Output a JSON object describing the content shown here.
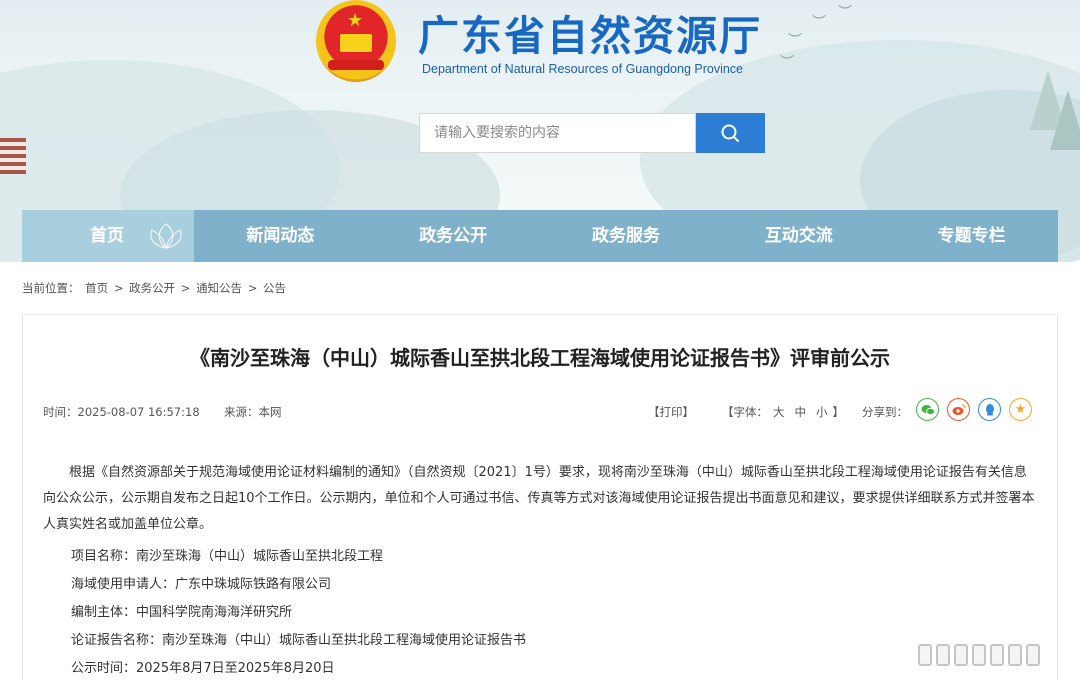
{
  "header": {
    "title": "广东省自然资源厅",
    "subtitle": "Department of Natural Resources of Guangdong Province",
    "search_placeholder": "请输入要搜索的内容"
  },
  "nav": {
    "items": [
      {
        "label": "首页",
        "active": true
      },
      {
        "label": "新闻动态"
      },
      {
        "label": "政务公开"
      },
      {
        "label": "政务服务"
      },
      {
        "label": "互动交流"
      },
      {
        "label": "专题专栏"
      }
    ]
  },
  "breadcrumb": {
    "prefix": "当前位置：",
    "items": [
      "首页",
      "政务公开",
      "通知公告",
      "公告"
    ],
    "separator": ">"
  },
  "article": {
    "title": "《南沙至珠海（中山）城际香山至拱北段工程海域使用论证报告书》评审前公示",
    "time": "时间：2025-08-07 16:57:18",
    "source": "来源：本网",
    "print_label": "【打印】",
    "font_prefix": "【字体：",
    "font_large": "大",
    "font_medium": "中",
    "font_small": "小",
    "font_suffix": "】",
    "share_label": "分享到：",
    "share_icons": [
      {
        "name": "wechat-icon",
        "color": "#3fb53f"
      },
      {
        "name": "weibo-icon",
        "color": "#e8572d"
      },
      {
        "name": "qq-icon",
        "color": "#2e8de0"
      },
      {
        "name": "qzone-icon",
        "color": "#f3a92a"
      }
    ],
    "paragraph": "根据《自然资源部关于规范海域使用论证材料编制的通知》（自然资规〔2021〕1号）要求，现将南沙至珠海（中山）城际香山至拱北段工程海域使用论证报告有关信息向公众公示，公示期自发布之日起10个工作日。公示期内，单位和个人可通过书信、传真等方式对该海域使用论证报告提出书面意见和建议，要求提供详细联系方式并签署本人真实姓名或加盖单位公章。",
    "details": [
      "项目名称：南沙至珠海（中山）城际香山至拱北段工程",
      "海域使用申请人：广东中珠城际铁路有限公司",
      "编制主体：中国科学院南海海洋研究所",
      "论证报告名称：南沙至珠海（中山）城际香山至拱北段工程海域使用论证报告书",
      "公示时间：2025年8月7日至2025年8月20日"
    ]
  }
}
